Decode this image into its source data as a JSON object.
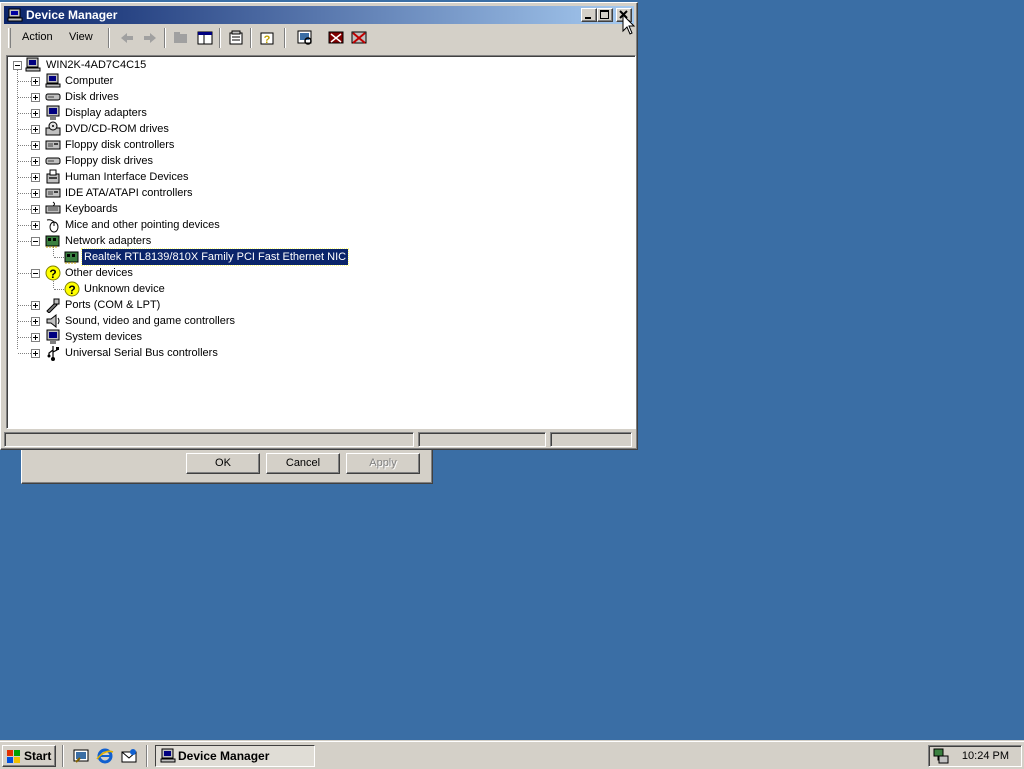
{
  "window": {
    "title": "Device Manager"
  },
  "menu": {
    "action": "Action",
    "view": "View"
  },
  "tree": {
    "root": "WIN2K-4AD7C4C15",
    "categories": [
      {
        "label": "Computer"
      },
      {
        "label": "Disk drives"
      },
      {
        "label": "Display adapters"
      },
      {
        "label": "DVD/CD-ROM drives"
      },
      {
        "label": "Floppy disk controllers"
      },
      {
        "label": "Floppy disk drives"
      },
      {
        "label": "Human Interface Devices"
      },
      {
        "label": "IDE ATA/ATAPI controllers"
      },
      {
        "label": "Keyboards"
      },
      {
        "label": "Mice and other pointing devices"
      },
      {
        "label": "Network adapters"
      },
      {
        "label": "Realtek RTL8139/810X Family PCI Fast Ethernet NIC"
      },
      {
        "label": "Other devices"
      },
      {
        "label": "Unknown device"
      },
      {
        "label": "Ports (COM & LPT)"
      },
      {
        "label": "Sound, video and game controllers"
      },
      {
        "label": "System devices"
      },
      {
        "label": "Universal Serial Bus controllers"
      }
    ]
  },
  "dialog": {
    "ok": "OK",
    "cancel": "Cancel",
    "apply": "Apply"
  },
  "taskbar": {
    "start": "Start",
    "task": "Device Manager",
    "clock": "10:24 PM"
  },
  "colors": {
    "desktop": "#3a6ea5",
    "title_active": "#0a246a",
    "face": "#d4d0c8"
  },
  "icons": {
    "toolbar": [
      "back-icon",
      "forward-icon",
      "up-folder-icon",
      "show-hide-tree-icon",
      "properties-icon",
      "help-icon",
      "scan-hardware-icon",
      "uninstall-icon",
      "disable-icon"
    ]
  }
}
